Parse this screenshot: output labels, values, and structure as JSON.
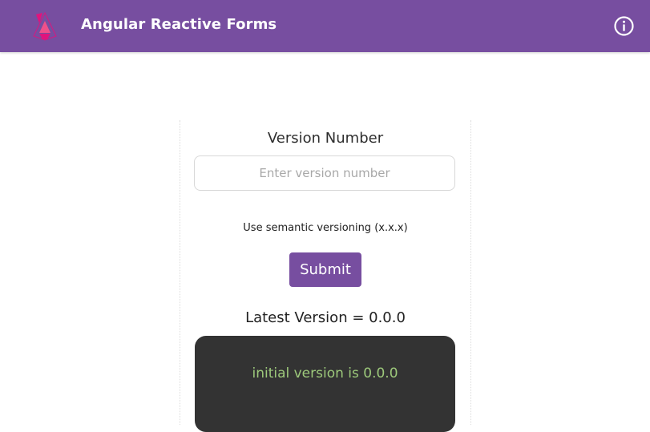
{
  "header": {
    "title": "Angular Reactive Forms",
    "logo_icon": "angular-logo-icon",
    "info_icon": "info-circle-icon"
  },
  "form": {
    "label": "Version Number",
    "input_value": "",
    "input_placeholder": "Enter version number",
    "hint": "Use semantic versioning (x.x.x)",
    "submit_label": "Submit"
  },
  "result": {
    "latest_version_text": "Latest Version = 0.0.0",
    "log_text": "initial version is 0.0.0"
  },
  "colors": {
    "brand": "#774ea0",
    "terminal_bg": "#333333",
    "terminal_text": "#9dc97b"
  }
}
